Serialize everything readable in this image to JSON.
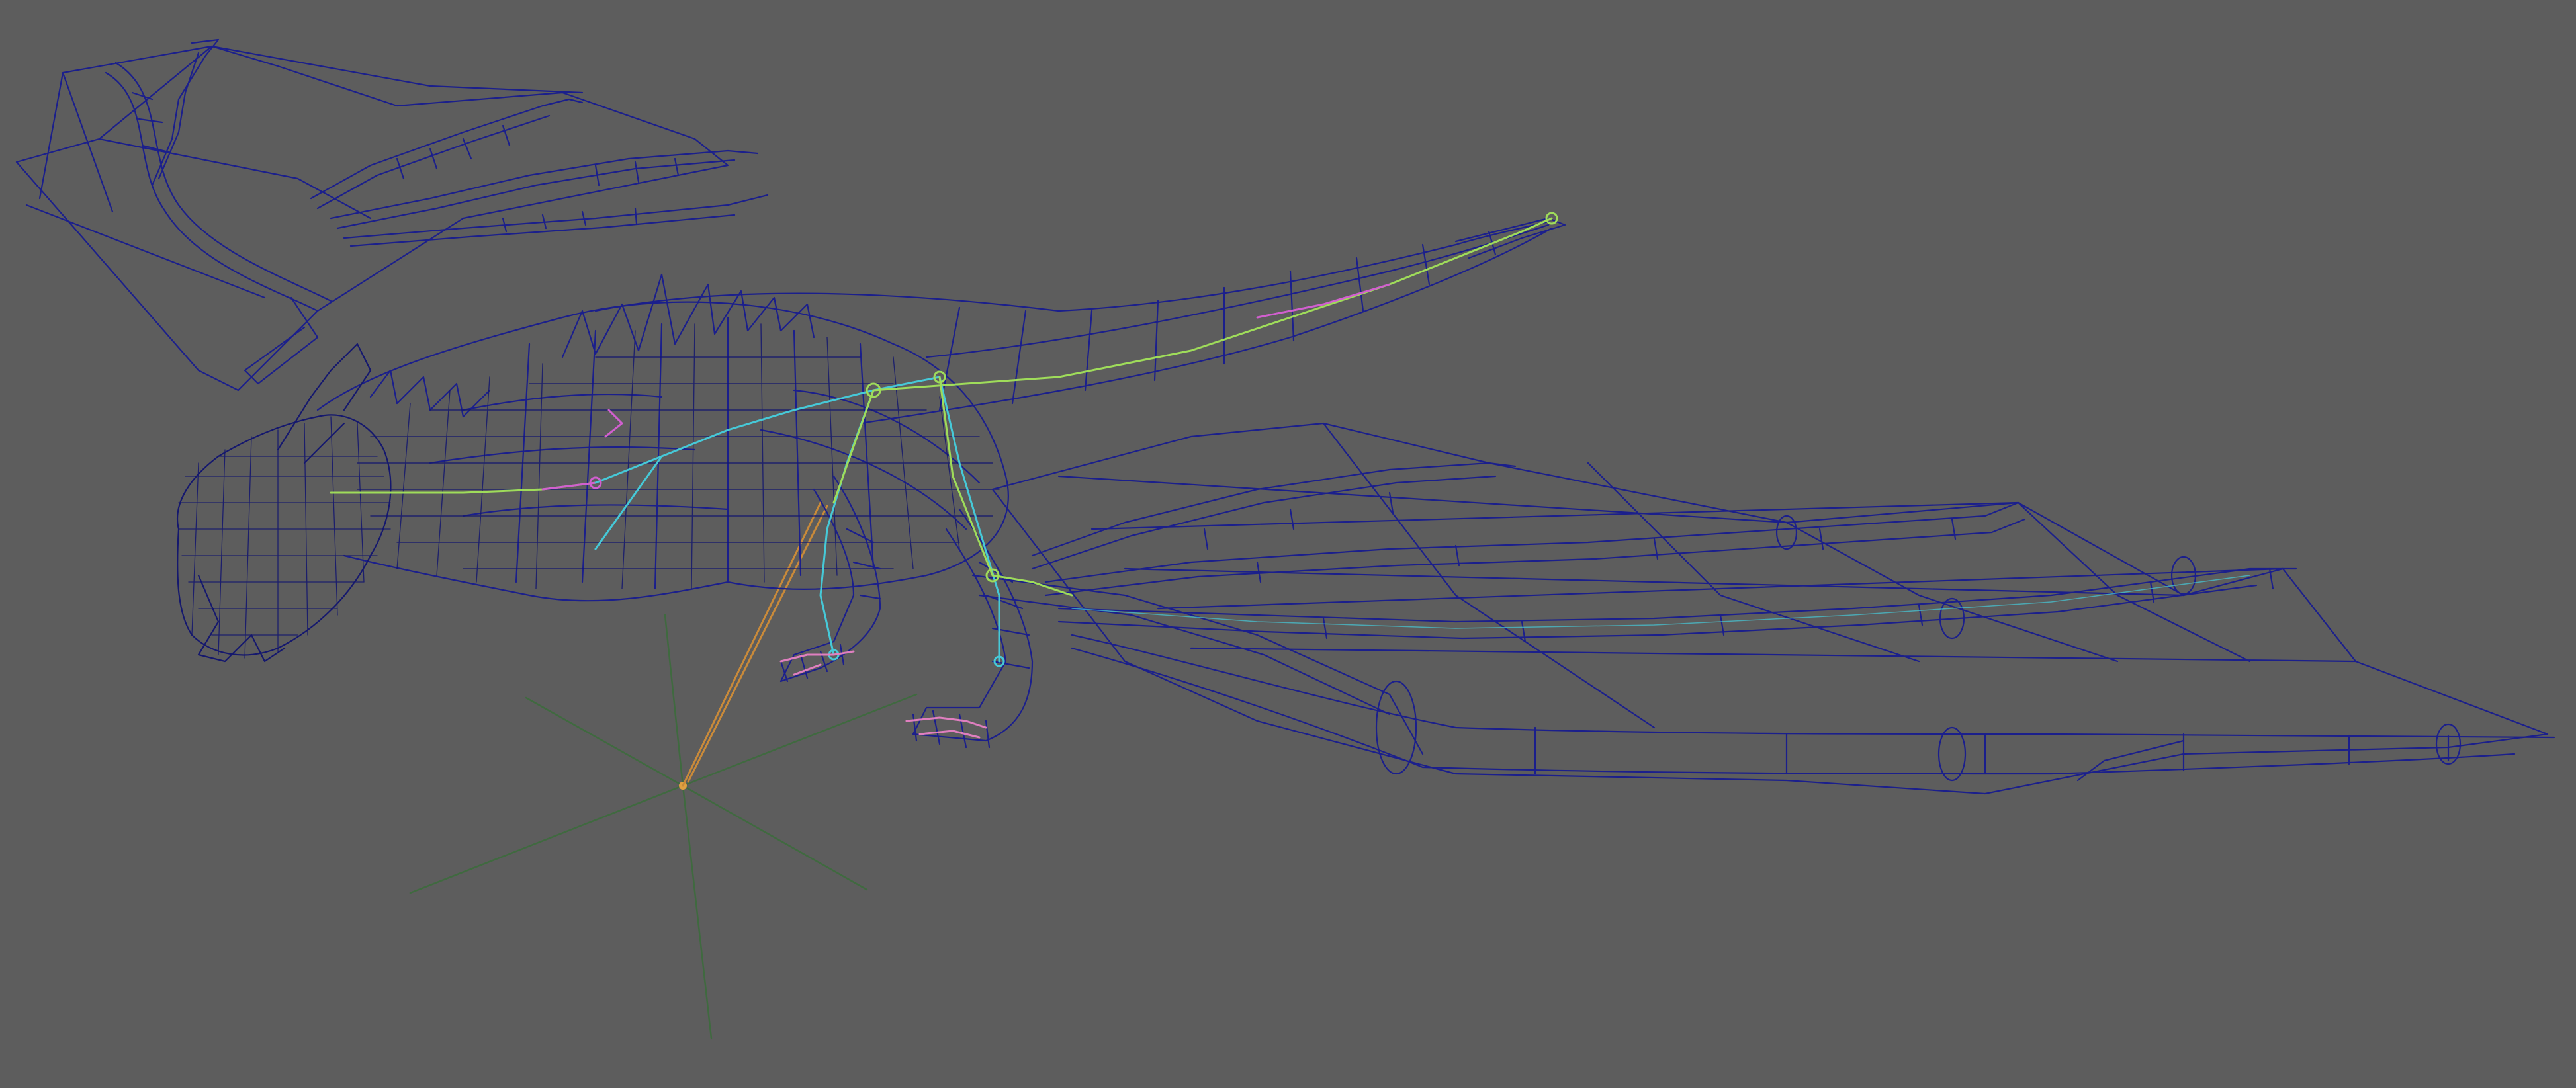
{
  "viewport": {
    "background_color": "#5d5d5d",
    "mode": "wireframe",
    "subject": "dragon-model-with-skeleton-rig"
  },
  "colors": {
    "mesh": "#1b1f8c",
    "mesh_dense": "#15186e",
    "grid_axis": "#3f6a3f",
    "ik_handle": "#c98a3a",
    "joint_green": "#9fdc5a",
    "joint_cyan": "#46c9d8",
    "joint_magenta": "#d25fd0",
    "joint_pink": "#e07fc0",
    "locator_center": "#e0a040"
  },
  "icons": {
    "locator": "locator-icon",
    "ik_handle": "ik-handle-icon"
  }
}
